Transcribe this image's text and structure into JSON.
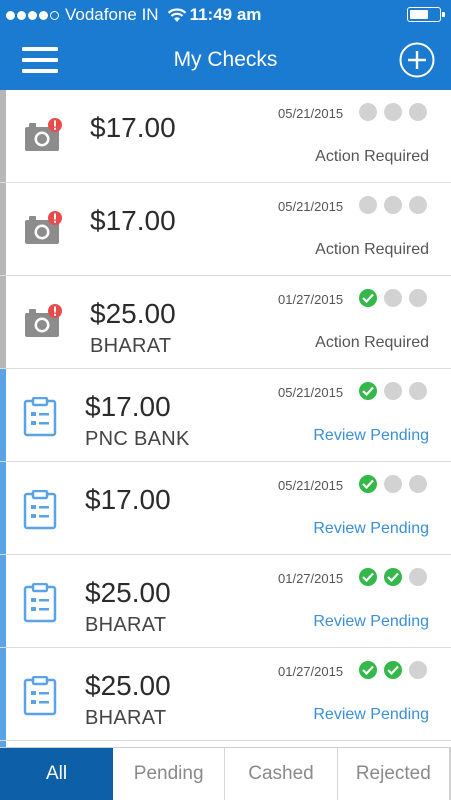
{
  "status_bar": {
    "carrier": "Vodafone IN",
    "time": "11:49 am"
  },
  "nav": {
    "title": "My Checks"
  },
  "colors": {
    "brand": "#1a7bd1",
    "active_tab": "#0d5fa8",
    "action_required_stripe": "#b7b7b7",
    "review_pending_stripe": "#5aa3e6",
    "review_pending_text": "#3a8fd6",
    "action_required_text": "#555555",
    "progress_done": "#35b84a",
    "progress_todo": "#d2d2d2",
    "alert_badge": "#e94b4b"
  },
  "checks": [
    {
      "icon": "camera-alert-icon",
      "amount": "$17.00",
      "payee": "",
      "date": "05/21/2015",
      "progress": [
        false,
        false,
        false
      ],
      "status": "Action Required",
      "status_type": "action"
    },
    {
      "icon": "camera-alert-icon",
      "amount": "$17.00",
      "payee": "",
      "date": "05/21/2015",
      "progress": [
        false,
        false,
        false
      ],
      "status": "Action Required",
      "status_type": "action"
    },
    {
      "icon": "camera-alert-icon",
      "amount": "$25.00",
      "payee": "BHARAT",
      "date": "01/27/2015",
      "progress": [
        true,
        false,
        false
      ],
      "status": "Action Required",
      "status_type": "action"
    },
    {
      "icon": "clipboard-icon",
      "amount": "$17.00",
      "payee": "PNC BANK",
      "date": "05/21/2015",
      "progress": [
        true,
        false,
        false
      ],
      "status": "Review Pending",
      "status_type": "review"
    },
    {
      "icon": "clipboard-icon",
      "amount": "$17.00",
      "payee": "",
      "date": "05/21/2015",
      "progress": [
        true,
        false,
        false
      ],
      "status": "Review Pending",
      "status_type": "review"
    },
    {
      "icon": "clipboard-icon",
      "amount": "$25.00",
      "payee": "BHARAT",
      "date": "01/27/2015",
      "progress": [
        true,
        true,
        false
      ],
      "status": "Review Pending",
      "status_type": "review"
    },
    {
      "icon": "clipboard-icon",
      "amount": "$25.00",
      "payee": "BHARAT",
      "date": "01/27/2015",
      "progress": [
        true,
        true,
        false
      ],
      "status": "Review Pending",
      "status_type": "review"
    },
    {
      "icon": "clipboard-icon",
      "amount": "",
      "payee": "",
      "date": "",
      "progress": [
        false,
        false,
        false
      ],
      "status": "",
      "status_type": "review"
    }
  ],
  "tabs": [
    {
      "label": "All",
      "active": true
    },
    {
      "label": "Pending",
      "active": false
    },
    {
      "label": "Cashed",
      "active": false
    },
    {
      "label": "Rejected",
      "active": false
    }
  ]
}
